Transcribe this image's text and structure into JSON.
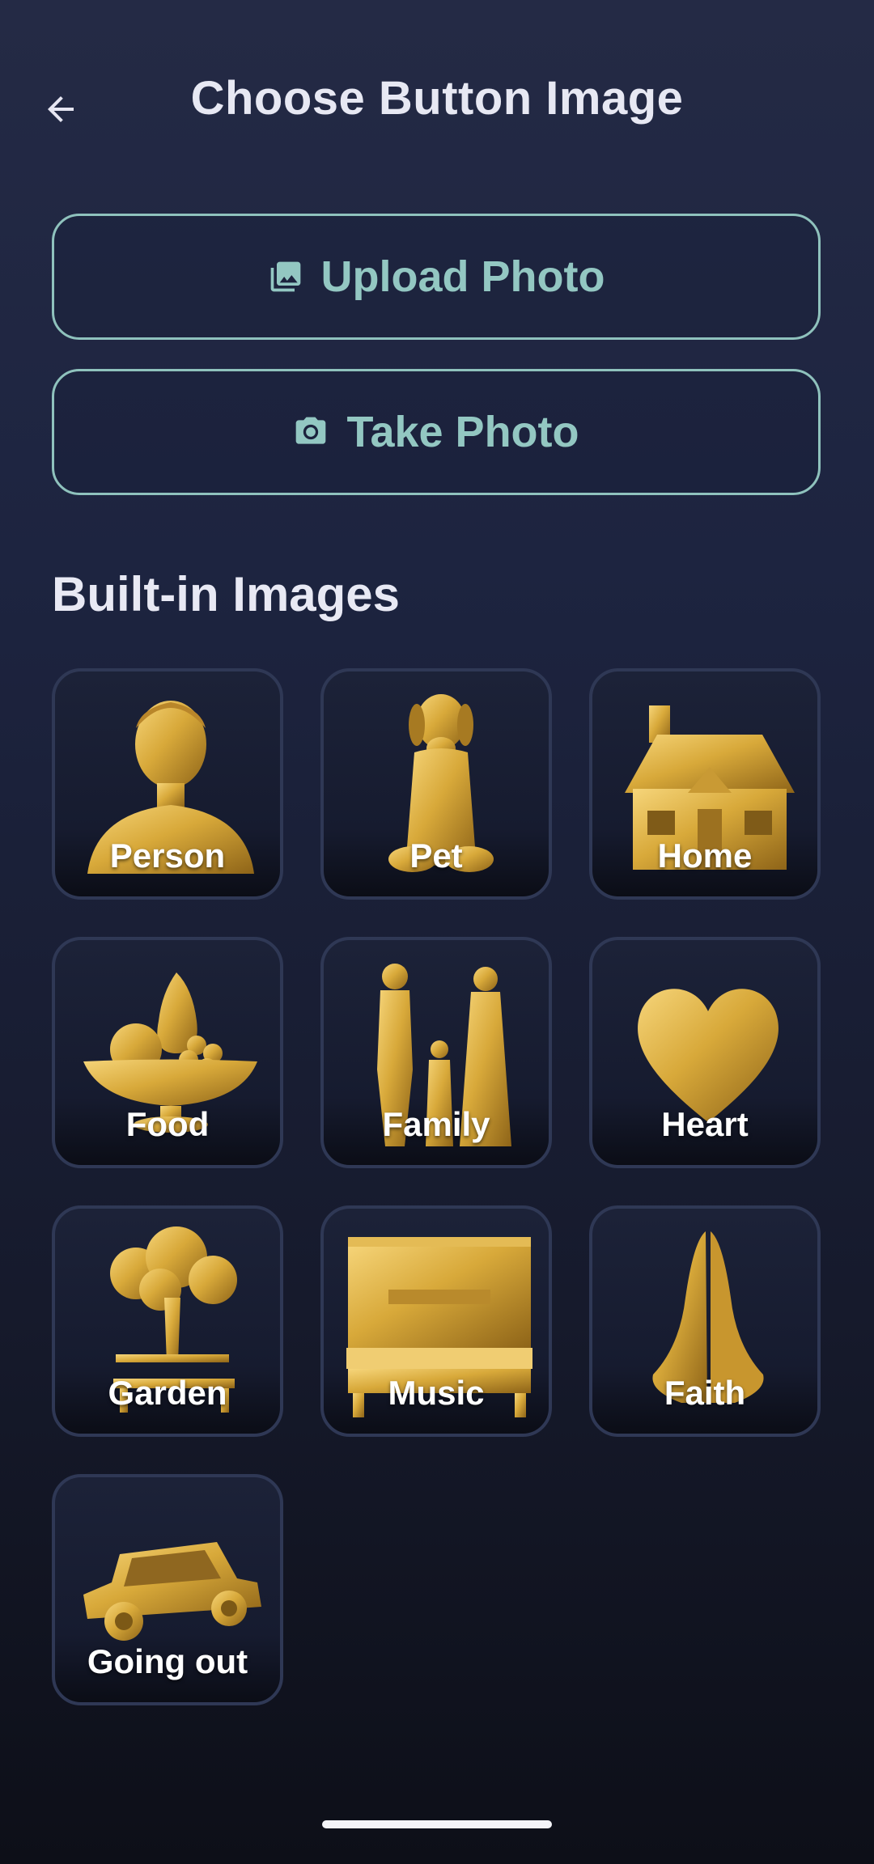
{
  "header": {
    "title": "Choose Button Image",
    "back_icon": "arrow-left-icon"
  },
  "actions": {
    "upload": {
      "label": "Upload Photo",
      "icon": "photo-library-icon"
    },
    "take": {
      "label": "Take Photo",
      "icon": "camera-icon"
    }
  },
  "section": {
    "title": "Built-in Images"
  },
  "images": [
    {
      "label": "Person",
      "icon": "person-bust-icon"
    },
    {
      "label": "Pet",
      "icon": "dog-icon"
    },
    {
      "label": "Home",
      "icon": "house-icon"
    },
    {
      "label": "Food",
      "icon": "fruit-bowl-icon"
    },
    {
      "label": "Family",
      "icon": "family-icon"
    },
    {
      "label": "Heart",
      "icon": "heart-icon"
    },
    {
      "label": "Garden",
      "icon": "tree-bench-icon"
    },
    {
      "label": "Music",
      "icon": "piano-icon"
    },
    {
      "label": "Faith",
      "icon": "praying-hands-icon"
    },
    {
      "label": "Going out",
      "icon": "car-icon"
    }
  ],
  "colors": {
    "accent": "#93c7c2",
    "gold": "#d4a83a",
    "tile_border": "#2f3855"
  }
}
